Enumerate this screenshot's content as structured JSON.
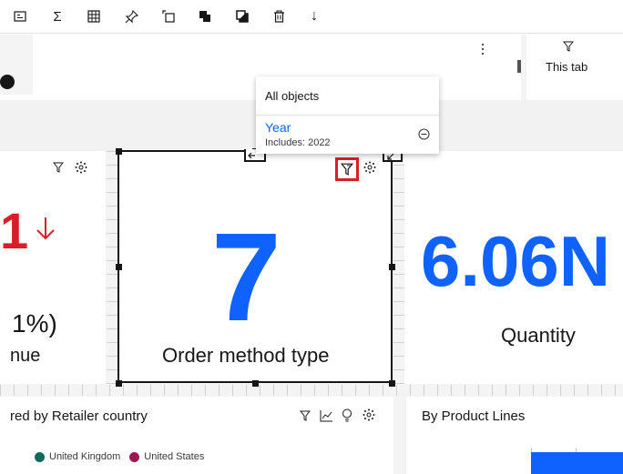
{
  "toolbar": {
    "buttons": [
      {
        "name": "data-items-button",
        "icon": "data-items-icon"
      },
      {
        "name": "summarize-button",
        "icon": "sigma-icon",
        "glyph": "Σ"
      },
      {
        "name": "table-button",
        "icon": "table-icon"
      },
      {
        "name": "pin-button",
        "icon": "pin-icon"
      },
      {
        "name": "duplicate-button",
        "icon": "copy-icon"
      },
      {
        "name": "bring-to-front-button",
        "icon": "bring-front-icon"
      },
      {
        "name": "send-to-back-button",
        "icon": "send-back-icon"
      },
      {
        "name": "delete-button",
        "icon": "trash-icon"
      },
      {
        "name": "download-button",
        "icon": "arrow-down-icon",
        "glyph": "↓"
      }
    ]
  },
  "tab_filter": {
    "label": "This tab",
    "icon": "filter-icon"
  },
  "popover": {
    "header": "All objects",
    "filter_item": {
      "name": "Year",
      "detail": "Includes: 2022"
    },
    "remove_icon": "remove-circle-icon"
  },
  "cards": {
    "left": {
      "value_fragment": "1",
      "change_pct": "1%)",
      "label_fragment": "nue",
      "trend_icon": "arrow-down-icon",
      "trend_color": "#da1e28"
    },
    "middle": {
      "value": "7",
      "label": "Order method type",
      "value_color": "#0f62fe"
    },
    "right": {
      "value": "6.06N",
      "label": "Quantity",
      "value_color": "#0f62fe"
    },
    "bottom_left": {
      "title": "red by Retailer country",
      "legend": [
        {
          "label": "United Kingdom",
          "color": "#0e6b5c"
        },
        {
          "label": "United States",
          "color": "#9f1853"
        }
      ]
    },
    "bottom_right": {
      "title": "By Product Lines"
    }
  },
  "colors": {
    "accent": "#0f62fe",
    "negative": "#da1e28",
    "selection": "#161616"
  }
}
